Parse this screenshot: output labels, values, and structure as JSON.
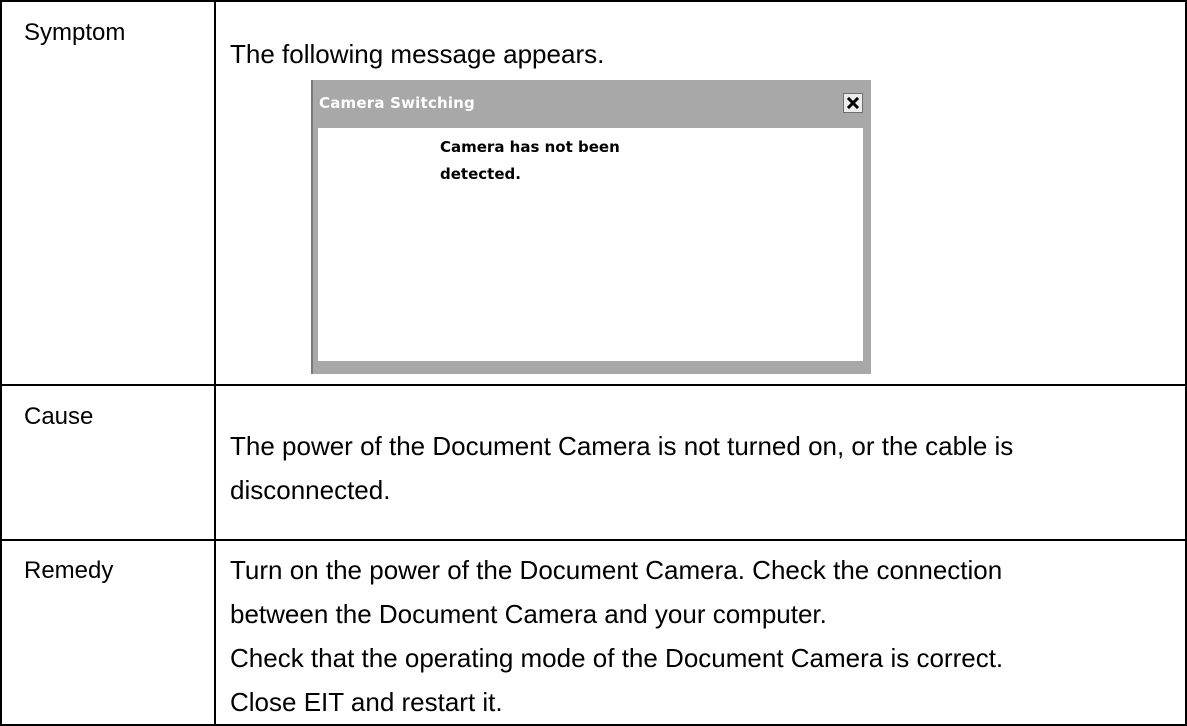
{
  "rows": {
    "symptom": {
      "label": "Symptom",
      "text": "The following message appears."
    },
    "cause": {
      "label": "Cause",
      "line1": "The power of the Document Camera is not turned on, or the cable is",
      "line2": "disconnected."
    },
    "remedy": {
      "label": "Remedy",
      "line1": "Turn on the power of the Document Camera. Check the connection",
      "line2": "between the Document Camera and your computer.",
      "line3": "Check that the operating mode of the Document Camera is correct.",
      "line4": "Close EIT and restart it."
    }
  },
  "dialog": {
    "title": "Camera Switching",
    "close_icon": "close-x-icon",
    "message_line1": "Camera has not been",
    "message_line2": "detected."
  },
  "colors": {
    "dialog_frame": "#a8a8a8",
    "dialog_title_text": "#ffffff",
    "border": "#000000"
  }
}
